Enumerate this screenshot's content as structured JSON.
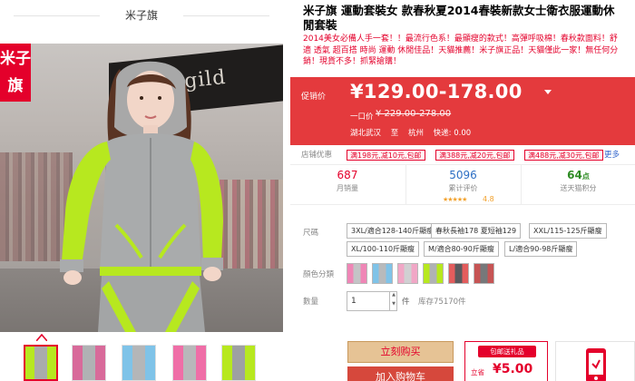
{
  "gallery": {
    "shop_name": "米子旗",
    "badge": "米子旗",
    "sign_text": "menegild",
    "thumb_count": 5
  },
  "product": {
    "title": "米子旗 運動套裝女 款春秋夏2014春裝新款女士衛衣服運動休閒套裝",
    "subtitle": "2014美女必備人手一套！！最流行色系！最顯瘦的款式！高彈呼吸棉！春秋款面料！舒適 透氣 超百搭 時尚 運動 休閒佳品！天貓推薦！米子旗正品！天貓僅此一家！無任何分銷！現貨不多！抓緊搶購！"
  },
  "price": {
    "label": "促销价",
    "value": "¥129.00-178.00",
    "original_label": "一口价",
    "original_value": "¥ 229.00-278.00",
    "ship_from": "湖北武汉",
    "ship_to_word": "至",
    "ship_to": "杭州",
    "ship_fee": "快递: 0.00"
  },
  "promotions": {
    "label": "店铺优惠",
    "items": [
      "满198元,减10元,包邮",
      "满388元,减20元,包邮",
      "满488元,减30元,包邮"
    ],
    "more": "更多"
  },
  "stats": {
    "sales_value": "687",
    "sales_label": "月销量",
    "reviews_value": "5096",
    "reviews_label": "累计评价",
    "rating": "4.8",
    "stars": "★★★★★",
    "points_value": "64",
    "points_unit": "点",
    "points_label": "送天猫积分"
  },
  "sku": {
    "size_label": "尺碼",
    "sizes": [
      "3XL/適合128-140斤顯瘦",
      "春秋長袖178 夏短袖129",
      "XXL/115-125斤顯瘦",
      "XL/100-110斤顯瘦",
      "M/適合80-90斤顯瘦",
      "L/適合90-98斤顯瘦"
    ],
    "color_label": "顏色分類",
    "quantity_label": "數量",
    "quantity_value": "1",
    "quantity_unit": "件",
    "stock": "库存75170件"
  },
  "actions": {
    "buy_now": "立刻购买",
    "add_to_cart": "加入购物车"
  },
  "app_promo": {
    "tag": "包邮送礼品",
    "price_label": "立省",
    "price": "¥5.00"
  },
  "colors": {
    "accent": "#e4002b",
    "price_panel": "#e43a3d",
    "lime": "#b7e81f"
  }
}
